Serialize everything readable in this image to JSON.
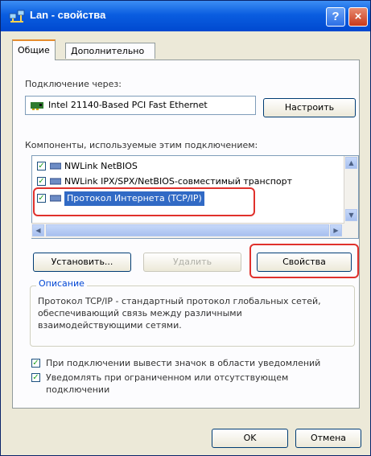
{
  "window": {
    "title": "Lan - свойства",
    "help_label": "?",
    "close_label": "×"
  },
  "tabs": [
    {
      "label": "Общие",
      "active": true
    },
    {
      "label": "Дополнительно",
      "active": false
    }
  ],
  "connection": {
    "label": "Подключение через:",
    "adapter": "Intel 21140-Based PCI Fast Ethernet",
    "configure_button": "Настроить"
  },
  "components": {
    "label": "Компоненты, используемые этим подключением:",
    "items": [
      {
        "label": "NWLink NetBIOS",
        "checked": true,
        "selected": false
      },
      {
        "label": "NWLink IPX/SPX/NetBIOS-совместимый транспорт",
        "checked": true,
        "selected": false
      },
      {
        "label": "Протокол Интернета (TCP/IP)",
        "checked": true,
        "selected": true
      }
    ],
    "scroll_up": "▲",
    "scroll_down": "▼",
    "scroll_left": "◀",
    "scroll_right": "▶"
  },
  "buttons": {
    "install": "Установить...",
    "uninstall": "Удалить",
    "properties": "Свойства"
  },
  "description": {
    "title": "Описание",
    "text": "Протокол TCP/IP - стандартный протокол глобальных сетей, обеспечивающий связь между различными взаимодействующими сетями."
  },
  "options": [
    {
      "label": "При подключении вывести значок в области уведомлений",
      "checked": true
    },
    {
      "label": "Уведомлять при ограниченном или отсутствующем подключении",
      "checked": true
    }
  ],
  "footer": {
    "ok": "OK",
    "cancel": "Отмена"
  },
  "colors": {
    "titlebar": "#0a5de0",
    "selection": "#316ac5",
    "highlight_annotation": "#e0312c"
  }
}
